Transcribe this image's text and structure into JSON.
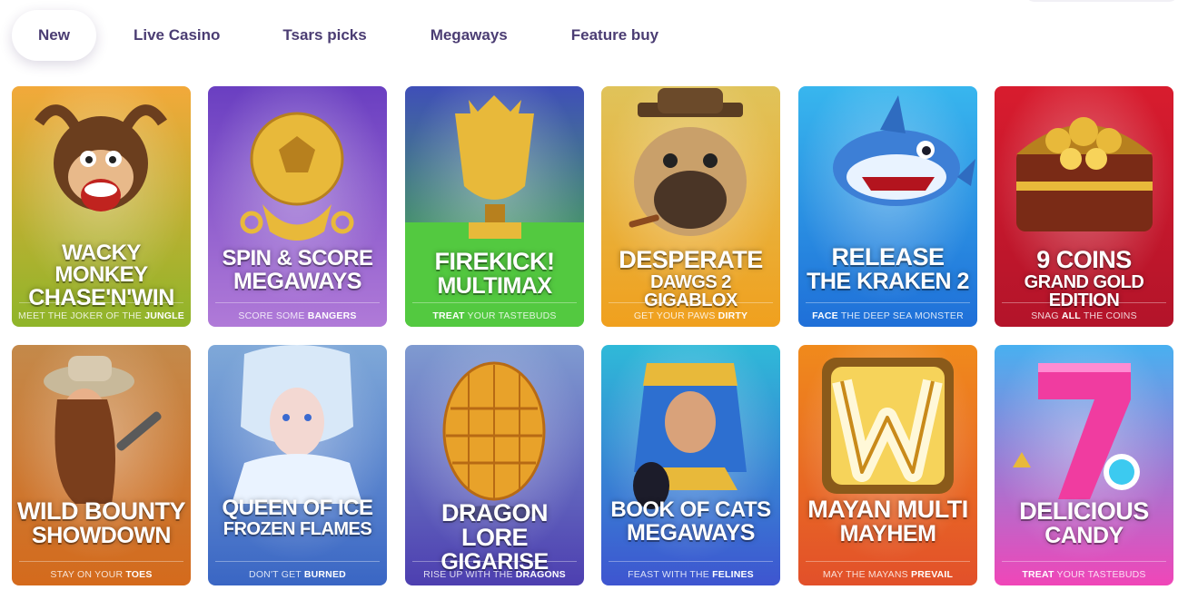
{
  "tabs": [
    {
      "label": "New",
      "active": true
    },
    {
      "label": "Live Casino",
      "active": false
    },
    {
      "label": "Tsars picks",
      "active": false
    },
    {
      "label": "Megaways",
      "active": false
    },
    {
      "label": "Feature buy",
      "active": false
    }
  ],
  "games": [
    {
      "title": "WACKY MONKEY",
      "subtitle": "CHASE'N'WIN",
      "tag_pre": "MEET THE JOKER OF THE ",
      "tag_bold": "JUNGLE",
      "tag_post": "",
      "colors": [
        "#f2a93a",
        "#8fb52a"
      ]
    },
    {
      "title": "SPIN & SCORE",
      "subtitle": "MEGAWAYS",
      "tag_pre": "SCORE SOME ",
      "tag_bold": "BANGERS",
      "tag_post": "",
      "colors": [
        "#6a3fc1",
        "#b07ad8"
      ]
    },
    {
      "title": "FIREKICK!",
      "subtitle": "MULTIMAX",
      "tag_pre": "",
      "tag_bold": "TREAT",
      "tag_post": " YOUR TASTEBUDS",
      "colors": [
        "#3f4fb8",
        "#4ec23a"
      ]
    },
    {
      "title": "DESPERATE",
      "subtitle": "DAWGS 2 GIGABLOX",
      "tag_pre": "GET YOUR PAWS ",
      "tag_bold": "DIRTY",
      "tag_post": "",
      "colors": [
        "#e0c35a",
        "#f0a01e"
      ]
    },
    {
      "title": "RELEASE",
      "subtitle": "THE KRAKEN 2",
      "tag_pre": "",
      "tag_bold": "FACE",
      "tag_post": " THE DEEP SEA MONSTER",
      "colors": [
        "#38b6ee",
        "#1f6fd8"
      ]
    },
    {
      "title": "9 COINS",
      "subtitle": "GRAND GOLD EDITION",
      "tag_pre": "SNAG ",
      "tag_bold": "ALL",
      "tag_post": " THE COINS",
      "colors": [
        "#d81c2e",
        "#b3142a"
      ]
    },
    {
      "title": "WILD BOUNTY",
      "subtitle": "SHOWDOWN",
      "tag_pre": "STAY ON YOUR ",
      "tag_bold": "TOES",
      "tag_post": "",
      "colors": [
        "#c4894a",
        "#d46a1c"
      ]
    },
    {
      "title": "QUEEN OF ICE",
      "subtitle": "FROZEN FLAMES",
      "tag_pre": "DON'T GET ",
      "tag_bold": "BURNED",
      "tag_post": "",
      "colors": [
        "#7fa8d8",
        "#3a66c4"
      ]
    },
    {
      "title": "DRAGON LORE",
      "subtitle": "GIGARISE",
      "tag_pre": "RISE UP WITH THE ",
      "tag_bold": "DRAGONS",
      "tag_post": "",
      "colors": [
        "#7f9ad0",
        "#4d3fb0"
      ]
    },
    {
      "title": "BOOK OF CATS",
      "subtitle": "MEGAWAYS",
      "tag_pre": "FEAST WITH THE ",
      "tag_bold": "FELINES",
      "tag_post": "",
      "colors": [
        "#2fb9d8",
        "#3e55d0"
      ]
    },
    {
      "title": "MAYAN MULTI",
      "subtitle": "MAYHEM",
      "tag_pre": "MAY THE MAYANS ",
      "tag_bold": "PREVAIL",
      "tag_post": "",
      "colors": [
        "#f08a1c",
        "#e2502a"
      ]
    },
    {
      "title": "DELICIOUS",
      "subtitle": "CANDY",
      "tag_pre": "",
      "tag_bold": "TREAT",
      "tag_post": " YOUR TASTEBUDS",
      "colors": [
        "#48b0f0",
        "#f046b8"
      ]
    }
  ]
}
